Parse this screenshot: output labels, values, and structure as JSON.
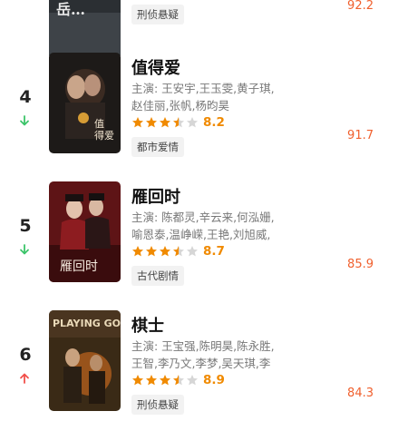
{
  "colors": {
    "accent_orange": "#f08a00",
    "heat_red": "#f0602e",
    "down_green": "#3cc46a",
    "up_red": "#f2504b",
    "star_gray": "#d6d6d6"
  },
  "rows": [
    {
      "tag": "刑侦悬疑",
      "heat": "92.2"
    },
    {
      "rank": "4",
      "trend": "down",
      "title": "值得爱",
      "cast_line1": "主演: 王安宇,王玉雯,黄子琪,",
      "cast_line2": "赵佳丽,张帆,杨昀昊",
      "stars": 3.5,
      "score": "8.2",
      "tag": "都市爱情",
      "heat": "91.7"
    },
    {
      "rank": "5",
      "trend": "down",
      "title": "雁回时",
      "cast_line1": "主演: 陈都灵,辛云来,何泓姗,",
      "cast_line2": "喻恩泰,温峥嵘,王艳,刘旭威,",
      "stars": 3.5,
      "score": "8.7",
      "tag": "古代剧情",
      "heat": "85.9"
    },
    {
      "rank": "6",
      "trend": "up",
      "title": "棋士",
      "cast_line1": "主演: 王宝强,陈明昊,陈永胜,",
      "cast_line2": "王智,李乃文,李梦,吴天琪,李",
      "stars": 3.5,
      "score": "8.9",
      "tag": "刑侦悬疑",
      "heat": "84.3"
    }
  ]
}
